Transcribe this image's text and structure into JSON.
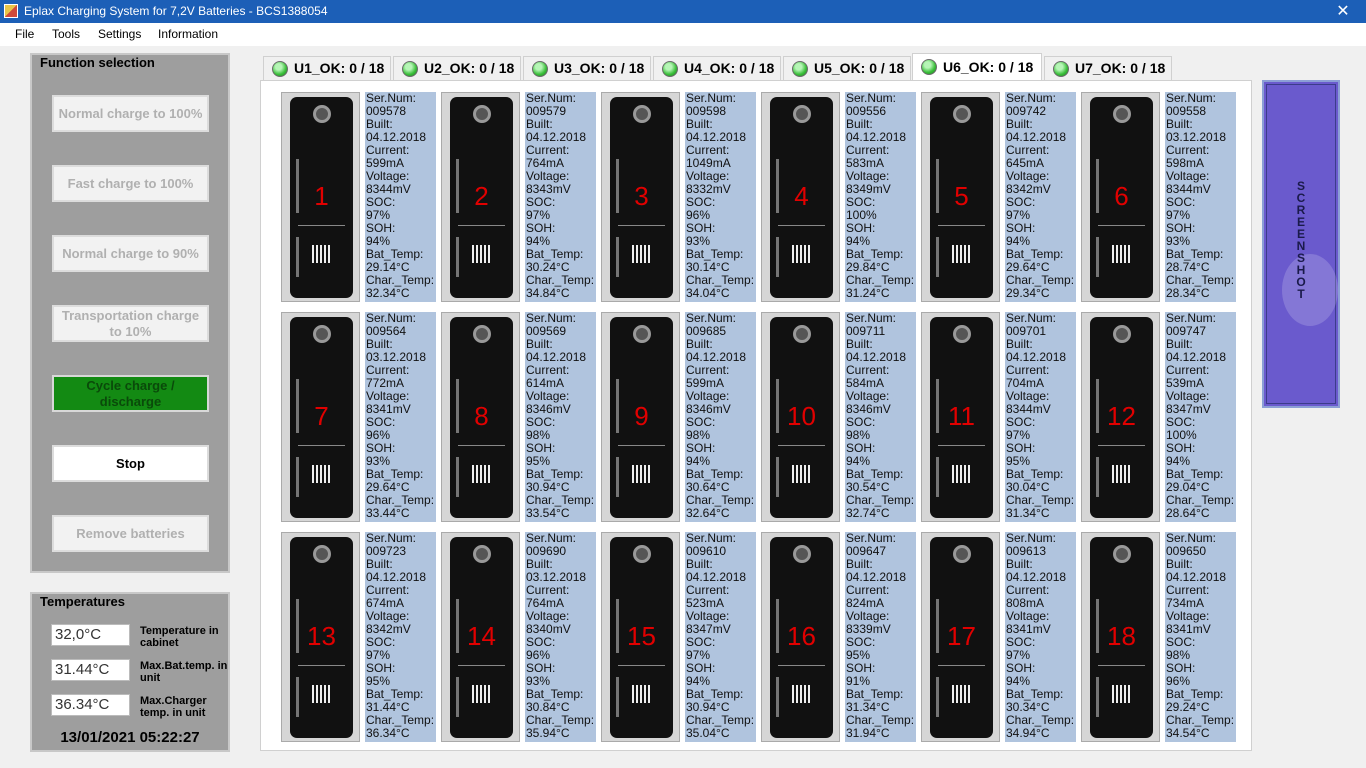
{
  "window": {
    "title": "Eplax Charging System for 7,2V Batteries - BCS1388054",
    "close_glyph": "✕"
  },
  "menu": [
    "File",
    "Tools",
    "Settings",
    "Information"
  ],
  "function_panel": {
    "title": "Function selection",
    "buttons": [
      {
        "label": "Normal charge to 100%",
        "state": "disabled"
      },
      {
        "label": "Fast charge to 100%",
        "state": "disabled"
      },
      {
        "label": "Normal charge to 90%",
        "state": "disabled"
      },
      {
        "label": "Transportation charge to 10%",
        "state": "disabled"
      },
      {
        "label": "Cycle charge / discharge",
        "state": "active"
      },
      {
        "label": "Stop",
        "state": "enabled"
      },
      {
        "label": "Remove batteries",
        "state": "disabled"
      }
    ]
  },
  "temperatures": {
    "title": "Temperatures",
    "rows": [
      {
        "value": "32,0°C",
        "label": "Temperature in cabinet"
      },
      {
        "value": "31.44°C",
        "label": "Max.Bat.temp. in unit"
      },
      {
        "value": "36.34°C",
        "label": "Max.Charger temp. in unit"
      }
    ],
    "datetime": "13/01/2021 05:22:27"
  },
  "tabs": [
    {
      "label": "U1_OK: 0 / 18"
    },
    {
      "label": "U2_OK: 0 / 18"
    },
    {
      "label": "U3_OK: 0 / 18"
    },
    {
      "label": "U4_OK: 0 / 18"
    },
    {
      "label": "U5_OK: 0 / 18"
    },
    {
      "label": "U6_OK: 0 / 18",
      "selected": true
    },
    {
      "label": "U7_OK: 0 / 18"
    }
  ],
  "field_labels": {
    "serial": "Ser.Num:",
    "built": "Built:",
    "current": "Current:",
    "voltage": "Voltage:",
    "soc": "SOC:",
    "soh": "SOH:",
    "bat_temp": "Bat_Temp:",
    "char_temp": "Char._Temp:"
  },
  "batteries": [
    {
      "num": "1",
      "serial": "009578",
      "built": "04.12.2018",
      "current": "599mA",
      "voltage": "8344mV",
      "soc": "97%",
      "soh": "94%",
      "bat_temp": "29.14°C",
      "char_temp": "32.34°C"
    },
    {
      "num": "2",
      "serial": "009579",
      "built": "04.12.2018",
      "current": "764mA",
      "voltage": "8343mV",
      "soc": "97%",
      "soh": "94%",
      "bat_temp": "30.24°C",
      "char_temp": "34.84°C"
    },
    {
      "num": "3",
      "serial": "009598",
      "built": "04.12.2018",
      "current": "1049mA",
      "voltage": "8332mV",
      "soc": "96%",
      "soh": "93%",
      "bat_temp": "30.14°C",
      "char_temp": "34.04°C"
    },
    {
      "num": "4",
      "serial": "009556",
      "built": "04.12.2018",
      "current": "583mA",
      "voltage": "8349mV",
      "soc": "100%",
      "soh": "94%",
      "bat_temp": "29.84°C",
      "char_temp": "31.24°C"
    },
    {
      "num": "5",
      "serial": "009742",
      "built": "04.12.2018",
      "current": "645mA",
      "voltage": "8342mV",
      "soc": "97%",
      "soh": "94%",
      "bat_temp": "29.64°C",
      "char_temp": "29.34°C"
    },
    {
      "num": "6",
      "serial": "009558",
      "built": "03.12.2018",
      "current": "598mA",
      "voltage": "8344mV",
      "soc": "97%",
      "soh": "93%",
      "bat_temp": "28.74°C",
      "char_temp": "28.34°C"
    },
    {
      "num": "7",
      "serial": "009564",
      "built": "03.12.2018",
      "current": "772mA",
      "voltage": "8341mV",
      "soc": "96%",
      "soh": "93%",
      "bat_temp": "29.64°C",
      "char_temp": "33.44°C"
    },
    {
      "num": "8",
      "serial": "009569",
      "built": "04.12.2018",
      "current": "614mA",
      "voltage": "8346mV",
      "soc": "98%",
      "soh": "95%",
      "bat_temp": "30.94°C",
      "char_temp": "33.54°C"
    },
    {
      "num": "9",
      "serial": "009685",
      "built": "04.12.2018",
      "current": "599mA",
      "voltage": "8346mV",
      "soc": "98%",
      "soh": "94%",
      "bat_temp": "30.64°C",
      "char_temp": "32.64°C"
    },
    {
      "num": "10",
      "serial": "009711",
      "built": "04.12.2018",
      "current": "584mA",
      "voltage": "8346mV",
      "soc": "98%",
      "soh": "94%",
      "bat_temp": "30.54°C",
      "char_temp": "32.74°C"
    },
    {
      "num": "11",
      "serial": "009701",
      "built": "04.12.2018",
      "current": "704mA",
      "voltage": "8344mV",
      "soc": "97%",
      "soh": "95%",
      "bat_temp": "30.04°C",
      "char_temp": "31.34°C"
    },
    {
      "num": "12",
      "serial": "009747",
      "built": "04.12.2018",
      "current": "539mA",
      "voltage": "8347mV",
      "soc": "100%",
      "soh": "94%",
      "bat_temp": "29.04°C",
      "char_temp": "28.64°C"
    },
    {
      "num": "13",
      "serial": "009723",
      "built": "04.12.2018",
      "current": "674mA",
      "voltage": "8342mV",
      "soc": "97%",
      "soh": "95%",
      "bat_temp": "31.44°C",
      "char_temp": "36.34°C"
    },
    {
      "num": "14",
      "serial": "009690",
      "built": "03.12.2018",
      "current": "764mA",
      "voltage": "8340mV",
      "soc": "96%",
      "soh": "93%",
      "bat_temp": "30.84°C",
      "char_temp": "35.94°C"
    },
    {
      "num": "15",
      "serial": "009610",
      "built": "04.12.2018",
      "current": "523mA",
      "voltage": "8347mV",
      "soc": "97%",
      "soh": "94%",
      "bat_temp": "30.94°C",
      "char_temp": "35.04°C"
    },
    {
      "num": "16",
      "serial": "009647",
      "built": "04.12.2018",
      "current": "824mA",
      "voltage": "8339mV",
      "soc": "95%",
      "soh": "91%",
      "bat_temp": "31.34°C",
      "char_temp": "31.94°C"
    },
    {
      "num": "17",
      "serial": "009613",
      "built": "04.12.2018",
      "current": "808mA",
      "voltage": "8341mV",
      "soc": "97%",
      "soh": "94%",
      "bat_temp": "30.34°C",
      "char_temp": "34.94°C"
    },
    {
      "num": "18",
      "serial": "009650",
      "built": "04.12.2018",
      "current": "734mA",
      "voltage": "8341mV",
      "soc": "98%",
      "soh": "96%",
      "bat_temp": "29.24°C",
      "char_temp": "34.54°C"
    }
  ],
  "screenshot_button": {
    "label": "SCREENSHOT"
  },
  "colors": {
    "title_bar": "#1c5fb7",
    "active_button": "#138a13",
    "info_panel": "#b0c4de",
    "screenshot_button": "#6a5acd",
    "battery_number": "#e10000"
  }
}
